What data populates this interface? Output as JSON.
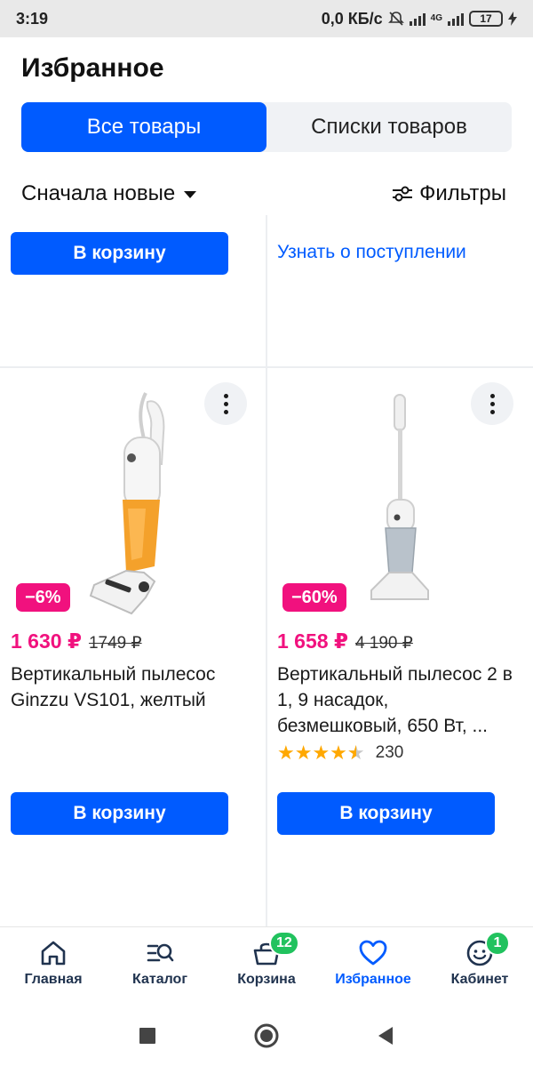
{
  "status_bar": {
    "time": "3:19",
    "net_speed": "0,0 КБ/с",
    "network": "4G",
    "battery": "17"
  },
  "header": {
    "title": "Избранное"
  },
  "tabs": [
    {
      "label": "Все товары",
      "active": true
    },
    {
      "label": "Списки товаров",
      "active": false
    }
  ],
  "sort": {
    "label": "Сначала новые"
  },
  "filters": {
    "label": "Фильтры"
  },
  "top_row": {
    "cart_button": "В корзину",
    "notify_link": "Узнать о поступлении"
  },
  "products": [
    {
      "discount": "−6%",
      "price": "1 630 ₽",
      "old_price": "1749 ₽",
      "title": "Вертикальный пылесос Ginzzu VS101, желтый",
      "cart_button": "В корзину"
    },
    {
      "discount": "−60%",
      "price": "1 658 ₽",
      "old_price": "4 190 ₽",
      "title": "Вертикальный пылесос 2 в 1, 9 насадок, безмешковый, 650 Вт, ...",
      "rating": 4.5,
      "reviews": "230",
      "cart_button": "В корзину"
    }
  ],
  "bottom_nav": [
    {
      "label": "Главная",
      "icon": "home-icon"
    },
    {
      "label": "Каталог",
      "icon": "catalog-search-icon"
    },
    {
      "label": "Корзина",
      "icon": "basket-icon",
      "badge": "12"
    },
    {
      "label": "Избранное",
      "icon": "heart-icon",
      "active": true
    },
    {
      "label": "Кабинет",
      "icon": "face-icon",
      "badge": "1"
    }
  ],
  "colors": {
    "accent": "#005bff",
    "sale": "#f1117e",
    "badge_green": "#21c25e",
    "star": "#ffa800"
  }
}
